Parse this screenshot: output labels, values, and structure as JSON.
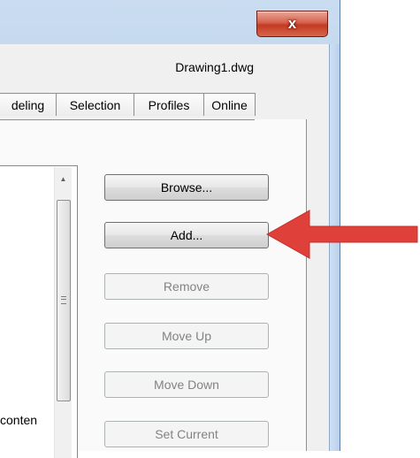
{
  "window": {
    "close_label": "x",
    "document_name": "Drawing1.dwg"
  },
  "tabs": [
    {
      "label": "deling"
    },
    {
      "label": "Selection"
    },
    {
      "label": "Profiles"
    },
    {
      "label": "Online"
    }
  ],
  "list": {
    "visible_text": "conten"
  },
  "buttons": {
    "browse": "Browse...",
    "add": "Add...",
    "remove": "Remove",
    "move_up": "Move Up",
    "move_down": "Move Down",
    "set_current": "Set Current"
  },
  "colors": {
    "arrow": "#e0403a",
    "close_button": "#c33a22"
  }
}
